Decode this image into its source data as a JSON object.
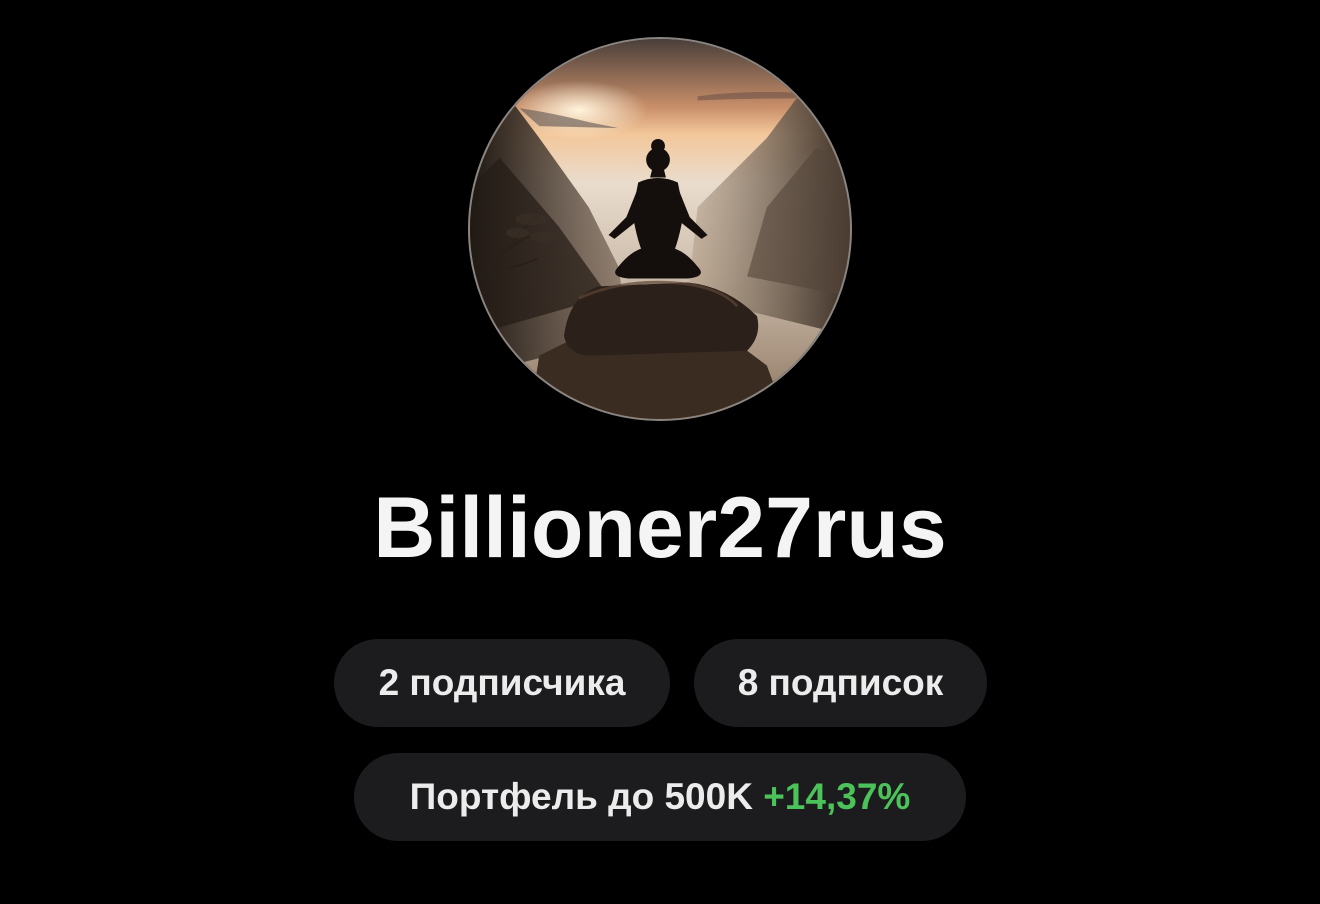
{
  "profile": {
    "username": "Billioner27rus",
    "avatar_icon": "meditation-avatar-image"
  },
  "stats": {
    "followers_label": "2 подписчика",
    "following_label": "8 подписок"
  },
  "portfolio": {
    "label": "Портфель до 500K",
    "change": "+14,37%"
  },
  "colors": {
    "background": "#000000",
    "pill_background": "#1c1c1e",
    "gain_green": "#4cc35a",
    "text": "#f2f2f2"
  }
}
